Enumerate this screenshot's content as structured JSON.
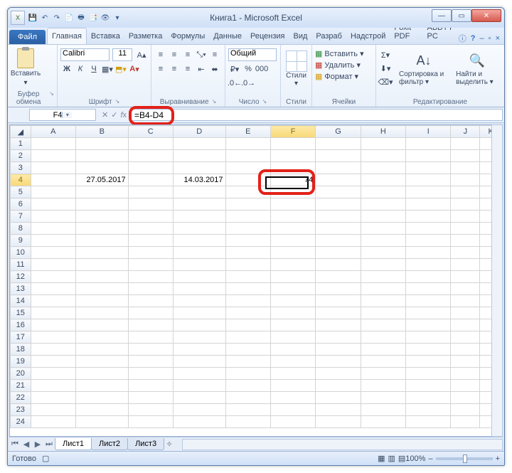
{
  "title": "Книга1 - Microsoft Excel",
  "qat": [
    "💾",
    "↶",
    "↷",
    "📄",
    "🖶",
    "📑",
    "👁",
    "▾"
  ],
  "tabs": {
    "file": "Файл",
    "items": [
      "Главная",
      "Вставка",
      "Разметка",
      "Формулы",
      "Данные",
      "Рецензия",
      "Вид",
      "Разраб",
      "Надстрой",
      "Foxit PDF",
      "ABBYY PС"
    ],
    "active": 0
  },
  "ribbon": {
    "clipboard": {
      "paste": "Вставить",
      "label": "Буфер обмена"
    },
    "font": {
      "name": "Calibri",
      "size": "11",
      "label": "Шрифт"
    },
    "align": {
      "wrap": "≡",
      "merge": "⬌",
      "label": "Выравнивание"
    },
    "number": {
      "fmt": "Общий",
      "label": "Число"
    },
    "styles": {
      "btn": "Стили",
      "label": "Стили"
    },
    "cells": {
      "insert": "Вставить ▾",
      "delete": "Удалить ▾",
      "format": "Формат ▾",
      "label": "Ячейки"
    },
    "editing": {
      "sort": "Сортировка и фильтр ▾",
      "find": "Найти и выделить ▾",
      "label": "Редактирование"
    }
  },
  "namebox": "F4",
  "formula": "=B4-D4",
  "columns": [
    "A",
    "B",
    "C",
    "D",
    "E",
    "F",
    "G",
    "H",
    "I",
    "J",
    "K"
  ],
  "cells": {
    "B4": "27.05.2017",
    "D4": "14.03.2017",
    "F4": "74"
  },
  "sheets": [
    "Лист1",
    "Лист2",
    "Лист3"
  ],
  "status": "Готово",
  "zoom": "100%",
  "winctrl": {
    "min": "—",
    "max": "▭",
    "close": "✕"
  }
}
